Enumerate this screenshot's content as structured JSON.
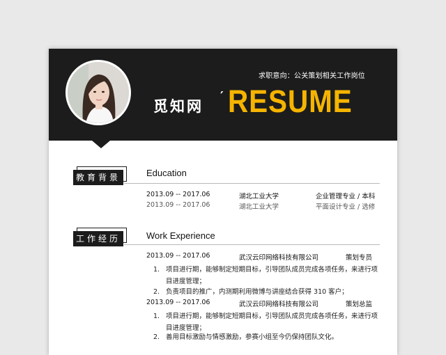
{
  "header": {
    "job_intent": "求职意向：公关策划相关工作岗位",
    "brand": "觅知网",
    "brand_mark": "′",
    "title": "RESUME",
    "accent_color": "#f5b400"
  },
  "education": {
    "badge": "教育背景",
    "title": "Education",
    "rows": [
      {
        "period": "2013.09 -- 2017.06",
        "school": "湖北工业大学",
        "major": "企业管理专业 / 本科"
      },
      {
        "period": "2013.09 -- 2017.06",
        "school": "湖北工业大学",
        "major": "平面设计专业 / 选修"
      }
    ]
  },
  "work": {
    "badge": "工作经历",
    "title": "Work    Experience",
    "jobs": [
      {
        "period": "2013.09 -- 2017.06",
        "company": "武汉云印网络科技有限公司",
        "role": "策划专员",
        "items": [
          {
            "num": "1.",
            "text": "项目进行期，能够制定短期目标，引导团队成员完成各项任务，来进行项目进度管理；"
          },
          {
            "num": "2.",
            "text": "负责项目的推广，内测期利用微博与讲座结合获得 310 客户；"
          }
        ]
      },
      {
        "period": "2013.09 -- 2017.06",
        "company": "武汉云印网络科技有限公司",
        "role": "策划总监",
        "items": [
          {
            "num": "1.",
            "text": "项目进行期，能够制定短期目标，引导团队成员完成各项任务，来进行项目进度管理；"
          },
          {
            "num": "2.",
            "text": "善用目标激励与情感激励，参赛小组至今仍保持团队文化。"
          }
        ]
      }
    ]
  }
}
